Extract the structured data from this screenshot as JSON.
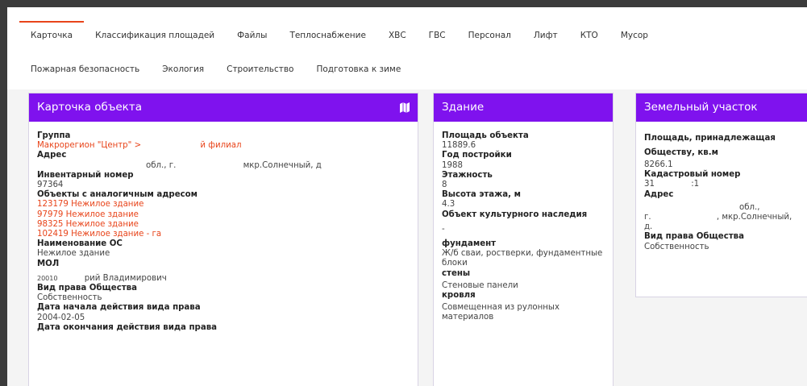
{
  "tabs_row1": [
    "Карточка",
    "Классификация площадей",
    "Файлы",
    "Теплоснабжение",
    "ХВС",
    "ГВС",
    "Персонал",
    "Лифт",
    "КТО",
    "Мусор"
  ],
  "tabs_row2": [
    "Пожарная безопасность",
    "Экология",
    "Строительство",
    "Подготовка к зиме"
  ],
  "active_tab": "Карточка",
  "card": {
    "title": "Карточка объекта",
    "icon": "map-icon",
    "group_label": "Группа",
    "group_value_a": "Макрорегион \"Центр\" >",
    "group_value_b": "й филиал",
    "address_label": "Адрес",
    "address_part_a": "обл., г.",
    "address_part_b": "мкр.Солнечный, д",
    "inv_label": "Инвентарный номер",
    "inv_value": "97364",
    "similar_label": "Объекты с аналогичным адресом",
    "similar_items": [
      "123179 Нежилое здание",
      "97979 Нежилое здание",
      "98325 Нежилое здание",
      "102419 Нежилое здание - га"
    ],
    "os_label": "Наименование ОС",
    "os_value": "Нежилое здание",
    "mol_label": "МОЛ",
    "mol_value_a": "20010",
    "mol_value_b": "рий Владимирович",
    "right_label": "Вид права Общества",
    "right_value": "Собственность",
    "start_label": "Дата начала действия вида права",
    "start_value": "2004-02-05",
    "end_label": "Дата окончания действия вида права"
  },
  "building": {
    "title": "Здание",
    "area_label": "Площадь объекта",
    "area_value": "11889.6",
    "year_label": "Год постройки",
    "year_value": "1988",
    "floors_label": "Этажность",
    "floors_value": "8",
    "height_label": "Высота этажа, м",
    "height_value": "4.3",
    "heritage_label": "Объект культурного наследия",
    "heritage_value": "-",
    "foundation_label": "фундамент",
    "foundation_value": "Ж/б сваи, ростверки, фундаментные блоки",
    "walls_label": "стены",
    "walls_value": "Стеновые панели",
    "roof_label": "кровля",
    "roof_value": "Совмещенная из рулонных материалов"
  },
  "land": {
    "title": "Земельный участок",
    "area_label": "Площадь, принадлежащая Обществу, кв.м",
    "area_value": "8266.1",
    "cadastral_label": "Кадастровый номер",
    "cadastral_value_a": "31",
    "cadastral_value_b": ":1",
    "address_label": "Адрес",
    "address_part_a": "обл.,",
    "address_part_b": "г.",
    "address_part_c": ", мкр.Солнечный,",
    "address_part_d": "д.",
    "right_label": "Вид права Общества",
    "right_value": "Собственность"
  },
  "colors": {
    "accent": "#7f12ee",
    "link": "#e8441a"
  }
}
